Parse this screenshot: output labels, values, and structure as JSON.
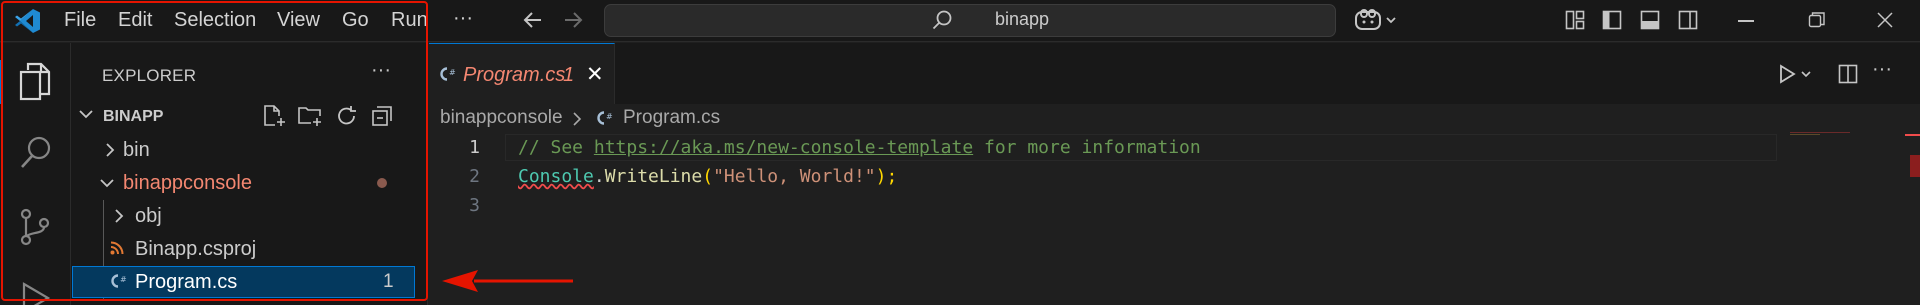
{
  "titlebar": {
    "menu": [
      "File",
      "Edit",
      "Selection",
      "View",
      "Go",
      "Run"
    ],
    "more_label": "···",
    "search_text": "binapp"
  },
  "explorer": {
    "title": "EXPLORER",
    "more_label": "···",
    "workspace": "BINAPP",
    "items": [
      {
        "label": "bin",
        "type": "folder",
        "expanded": false
      },
      {
        "label": "binappconsole",
        "type": "folder",
        "expanded": true,
        "modified": true
      },
      {
        "label": "obj",
        "type": "folder",
        "expanded": false
      },
      {
        "label": "Binapp.csproj",
        "type": "file",
        "icon": "rss-icon"
      },
      {
        "label": "Program.cs",
        "type": "file",
        "icon": "csharp-icon",
        "badge": "1",
        "selected": true
      }
    ]
  },
  "editor": {
    "tab": {
      "title": "Program.cs",
      "badge": "1",
      "close": "✕"
    },
    "breadcrumb": [
      "binappconsole",
      "Program.cs"
    ],
    "lines": [
      {
        "num": "1",
        "comment_prefix": "// See ",
        "link": "https://aka.ms/new-console-template",
        "comment_suffix": " for more information"
      },
      {
        "num": "2",
        "class": "Console",
        "dot": ".",
        "method": "WriteLine",
        "open": "(",
        "string": "\"Hello, World!\"",
        "close": ");"
      },
      {
        "num": "3"
      }
    ]
  },
  "colors": {
    "accent": "#0078d4",
    "annotation": "#e51400",
    "error": "#f48771",
    "comment": "#6a9955",
    "class": "#4ec9b0",
    "method": "#dcdcaa",
    "string": "#ce9178"
  }
}
